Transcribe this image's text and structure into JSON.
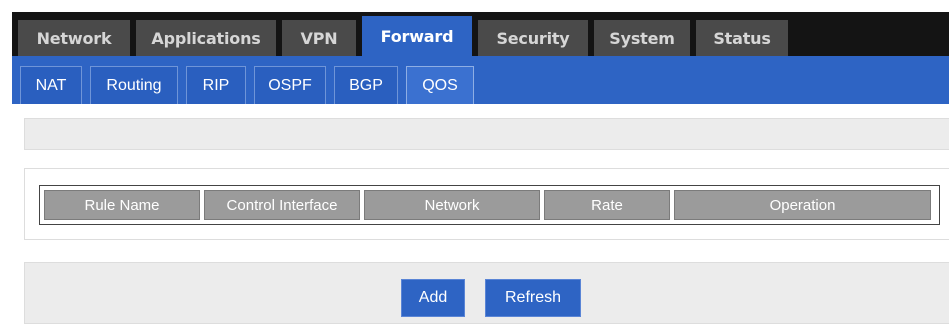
{
  "main_nav": {
    "tabs": [
      {
        "label": "Network",
        "active": false
      },
      {
        "label": "Applications",
        "active": false
      },
      {
        "label": "VPN",
        "active": false
      },
      {
        "label": "Forward",
        "active": true
      },
      {
        "label": "Security",
        "active": false
      },
      {
        "label": "System",
        "active": false
      },
      {
        "label": "Status",
        "active": false
      }
    ]
  },
  "sub_nav": {
    "tabs": [
      {
        "label": "NAT",
        "active": false
      },
      {
        "label": "Routing",
        "active": false
      },
      {
        "label": "RIP",
        "active": false
      },
      {
        "label": "OSPF",
        "active": false
      },
      {
        "label": "BGP",
        "active": false
      },
      {
        "label": "QOS",
        "active": true
      }
    ]
  },
  "table": {
    "columns": [
      "Rule Name",
      "Control Interface",
      "Network",
      "Rate",
      "Operation"
    ]
  },
  "actions": {
    "add_label": "Add",
    "refresh_label": "Refresh"
  },
  "colors": {
    "accent": "#2e64c4",
    "nav_bg": "#141414",
    "tab_inactive": "#4a4a4a",
    "header_cell": "#9b9b9b"
  }
}
